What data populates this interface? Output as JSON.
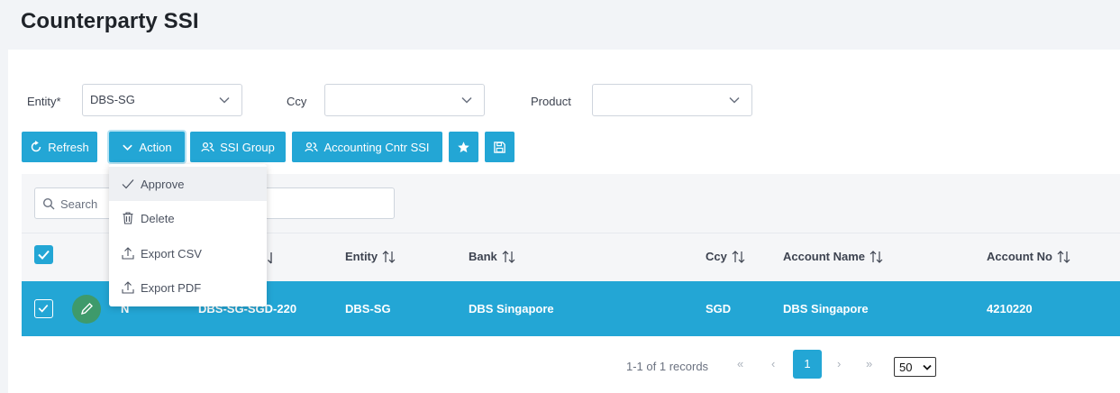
{
  "page": {
    "title": "Counterparty SSI"
  },
  "filters": {
    "entity_label": "Entity*",
    "entity_value": "DBS-SG",
    "ccy_label": "Ccy",
    "ccy_value": "",
    "product_label": "Product",
    "product_value": ""
  },
  "toolbar": {
    "refresh": "Refresh",
    "action": "Action",
    "ssi_group": "SSI Group",
    "accounting_cntr_ssi": "Accounting Cntr SSI",
    "favorite_icon": "star-icon",
    "save_icon": "save-icon"
  },
  "action_menu": {
    "items": [
      {
        "label": "Approve",
        "icon": "check-icon",
        "highlighted": true
      },
      {
        "label": "Delete",
        "icon": "trash-icon"
      },
      {
        "label": "Export CSV",
        "icon": "upload-icon"
      },
      {
        "label": "Export PDF",
        "icon": "upload-icon"
      }
    ]
  },
  "search": {
    "placeholder": "Search"
  },
  "table": {
    "columns": [
      "Entity",
      "Bank",
      "Ccy",
      "Account Name",
      "Account No"
    ],
    "rows": [
      {
        "selected": true,
        "flag": "N",
        "code": "DBS-SG-SGD-220",
        "entity": "DBS-SG",
        "bank": "DBS Singapore",
        "ccy": "SGD",
        "account_name": "DBS Singapore",
        "account_no": "4210220"
      }
    ]
  },
  "pagination": {
    "summary": "1-1 of 1 records",
    "first": "«",
    "prev": "‹",
    "current_page": "1",
    "next": "›",
    "last": "»",
    "page_size": "50"
  },
  "colors": {
    "accent": "#23a6d5",
    "edit": "#3e9a6b"
  }
}
